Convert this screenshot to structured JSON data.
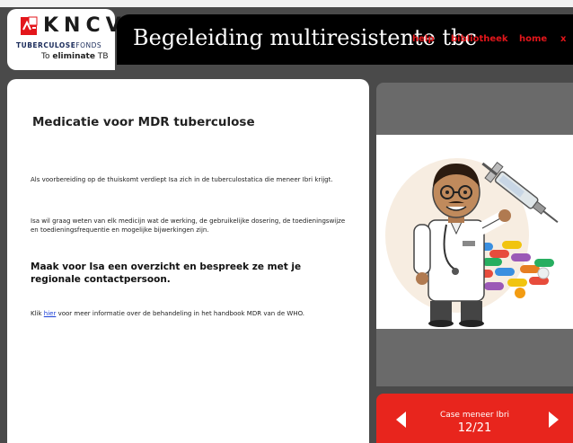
{
  "brand": {
    "name": "KNCV",
    "fonds_prefix": "TUBERCULOSE",
    "fonds_suffix": "FONDS",
    "tagline_prefix": "To ",
    "tagline_bold": "eliminate",
    "tagline_suffix": " TB"
  },
  "header": {
    "title": "Begeleiding multiresistente tbc",
    "nav": {
      "help": "help",
      "library": "bibliotheek",
      "home": "home",
      "close": "x"
    }
  },
  "content": {
    "heading": "Medicatie voor MDR tuberculose",
    "para1": "Als voorbereiding op de thuiskomt verdiept Isa zich in de tuberculostatica die meneer Ibri krijgt.",
    "para2": "Isa wil graag weten van elk medicijn wat de werking, de gebruikelijke dosering, de toedieningswijze en toedieningsfrequentie en mogelijke bijwerkingen zijn.",
    "assignment": "Maak voor Isa een overzicht en bespreek ze met je regionale contactpersoon.",
    "info_prefix": "Klik ",
    "info_link": "hier",
    "info_suffix": " voor meer informatie over de behandeling in het handbook MDR van de WHO."
  },
  "case": {
    "name": "Case meneer Ibri",
    "progress": "12/21"
  },
  "colors": {
    "accent_red": "#e8251d",
    "nav_red": "#e3161b",
    "background_dark": "#4a4a4a",
    "panel_grey": "#6a6a6a",
    "link_blue": "#1a3fd6"
  },
  "icons": {
    "logo": "kncv-logo-icon",
    "illustration": "doctor-with-syringe-illustration",
    "prev": "arrow-left-icon",
    "next": "arrow-right-icon"
  }
}
